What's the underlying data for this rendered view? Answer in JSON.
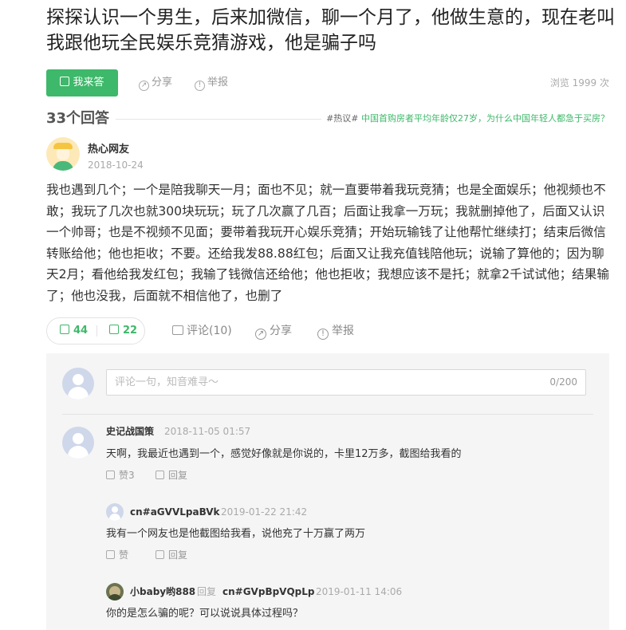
{
  "question": {
    "title": "探探认识一个男生，后来加微信，聊一个月了，他做生意的，现在老叫我跟他玩全民娱乐竞猜游戏，他是骗子吗"
  },
  "actions": {
    "answer_label": "我来答",
    "share_label": "分享",
    "report_label": "举报",
    "views_text": "浏览 1999 次"
  },
  "answers_header": {
    "count_text": "33个回答",
    "hot_tag": "#热议#",
    "hot_topic": "中国首购房者平均年龄仅27岁，为什么中国年轻人都急于买房？"
  },
  "answer": {
    "author_name": "热心网友",
    "date": "2018-10-24",
    "text": "我也遇到几个；一个是陪我聊天一月；面也不见；就一直要带着我玩竞猜；也是全面娱乐；他视频也不敢；我玩了几次也就300块玩玩；玩了几次赢了几百；后面让我拿一万玩；我就删掉他了，后面又认识一个帅哥；也是不视频不见面；要带着我玩开心娱乐竞猜；开始玩输钱了让他帮忙继续打；结束后微信转账给他；他也拒收；不要。还给我发88.88红包；后面又让我充值钱陪他玩；说输了算他的；因为聊天2月；看他给我发红包；我输了钱微信还给他；他也拒收；我想应该不是托；就拿2千试试他；结果输了；他也没我，后面就不相信他了，也删了",
    "up_count": "44",
    "down_count": "22",
    "comment_label": "评论(10)",
    "share_label": "分享",
    "report_label": "举报"
  },
  "comments": {
    "input_placeholder": "评论一句，知音难寻～",
    "input_counter": "0/200",
    "items": [
      {
        "user": "史记战国策",
        "date": "2018-11-05 01:57",
        "text": "天啊，我最近也遇到一个，感觉好像就是你说的，卡里12万多，截图给我看的",
        "like_label": "赞3",
        "reply_label": "回复"
      },
      {
        "user": "cn#aGVVLpaBVk",
        "date": "2019-01-22 21:42",
        "text": "我有一个网友也是他截图给我看，说他充了十万赢了两万",
        "like_label": "赞",
        "reply_label": "回复"
      },
      {
        "user": "小baby哟888",
        "reply_word": "回复",
        "reply_to": "cn#GVpBpVQpLp",
        "date": "2019-01-11 14:06",
        "text": "你的是怎么骗的呢？可以说说具体过程吗？"
      }
    ]
  },
  "colors": {
    "accent": "#3eb86a",
    "muted": "#999999",
    "panel_bg": "#f5f5f5"
  },
  "icons": [
    "edit-icon",
    "share-icon",
    "report-icon",
    "thumb-up-icon",
    "thumb-down-icon",
    "comment-icon",
    "like-icon",
    "reply-icon"
  ]
}
